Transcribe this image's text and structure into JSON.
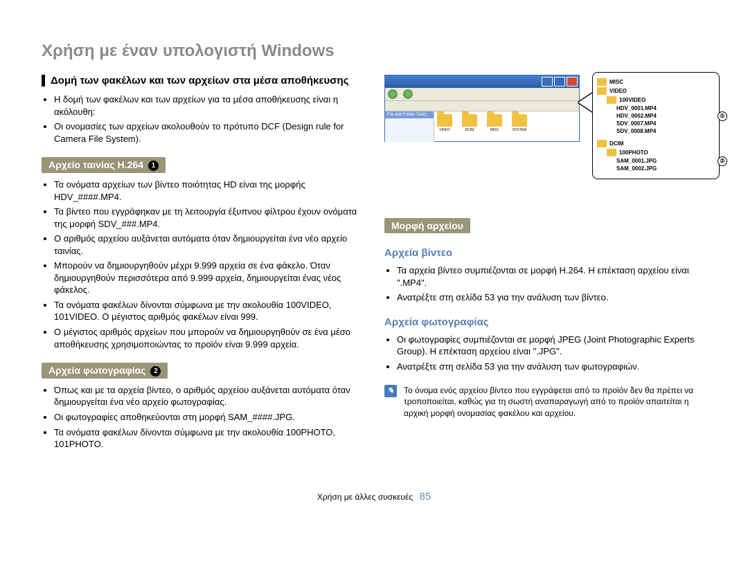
{
  "page_title": "Χρήση με έναν υπολογιστή Windows",
  "section1_title": "Δομή των φακέλων και των αρχείων στα μέσα αποθήκευσης",
  "section1_bullets": [
    "Η δομή των φακέλων και των αρχείων για τα μέσα αποθήκευσης είναι η ακόλουθη:",
    "Οι ονομασίες των αρχείων ακολουθούν το πρότυπο DCF (Design rule for Camera File System)."
  ],
  "sub1_title": "Αρχείο ταινίας H.264",
  "sub1_num": "1",
  "sub1_bullets": [
    "Τα ονόματα αρχείων των βίντεο ποιότητας HD είναι της μορφής HDV_####.MP4.",
    "Τα βίντεο που εγγράφηκαν με τη λειτουργία έξυπνου φίλτρου έχουν ονόματα της μορφή SDV_###.MP4.",
    "Ο αριθμός αρχείου αυξάνεται αυτόματα όταν δημιουργείται ένα νέο αρχείο ταινίας.",
    "Μπορούν να δημιουργηθούν μέχρι 9.999 αρχεία σε ένα φάκελο. Όταν δημιουργηθούν περισσότερα από 9.999 αρχεία, δημιουργείται ένας νέος φάκελος.",
    "Τα ονόματα φακέλων δίνονται σύμφωνα με την ακολουθία 100VIDEO, 101VIDEO. Ο μέγιστος αριθμός φακέλων είναι 999.",
    "Ο μέγιστος αριθμός αρχείων που μπορούν να δημιουργηθούν σε ένα μέσο αποθήκευσης χρησιμοποιώντας το προϊόν είναι 9.999 αρχεία."
  ],
  "sub2_title": "Αρχεία φωτογραφίας",
  "sub2_num": "2",
  "sub2_bullets": [
    "Όπως και με τα αρχεία βίντεο, ο αριθμός αρχείου αυξάνεται αυτόματα όταν δημιουργείται ένα νέο αρχείο φωτογραφίας.",
    "Οι φωτογραφίες αποθηκεύονται στη μορφή SAM_####.JPG.",
    "Τα ονόματα φακέλων δίνονται σύμφωνα με την ακολουθία 100PHOTO, 101PHOTO."
  ],
  "format_title": "Μορφή αρχείου",
  "video_title": "Αρχεία βίντεο",
  "video_bullets": [
    "Τα αρχεία βίντεο συμπιέζονται σε μορφή H.264. Η επέκταση αρχείου είναι \".MP4\".",
    "Ανατρέξτε στη σελίδα 53 για την ανάλυση των βίντεο."
  ],
  "photo_title": "Αρχεία φωτογραφίας",
  "photo_bullets": [
    "Οι φωτογραφίες συμπιέζονται σε μορφή JPEG (Joint Photographic Experts Group). Η επέκταση αρχείου είναι \".JPG\".",
    "Ανατρέξτε στη σελίδα 53 για την ανάλυση των φωτογραφιών."
  ],
  "note_text": "Το όνομα ενός αρχείου βίντεο που εγγράφεται από το προϊόν δεν θα πρέπει να τροποποιείται, καθώς για τη σωστή αναπαραγωγή από το προϊόν απαιτείται η αρχική μορφή ονομασίας φακέλου και αρχείου.",
  "footer_text": "Χρήση με άλλες συσκευές",
  "footer_page": "85",
  "explorer": {
    "side_panel": "File and Folder Tasks",
    "folders": [
      "VIDEO",
      "DCIM",
      "MISC",
      "SYSTEM"
    ]
  },
  "tree": {
    "misc": "MISC",
    "video": "VIDEO",
    "v100": "100VIDEO",
    "hdv1": "HDV_0001.MP4",
    "hdv2": "HDV_0002.MP4",
    "sdv7": "SDV_0007.MP4",
    "sdv8": "SDV_0008.MP4",
    "dcim": "DCIM",
    "p100": "100PHOTO",
    "sam1": "SAM_0001.JPG",
    "sam2": "SAM_0002.JPG",
    "call1": "①",
    "call2": "②"
  }
}
